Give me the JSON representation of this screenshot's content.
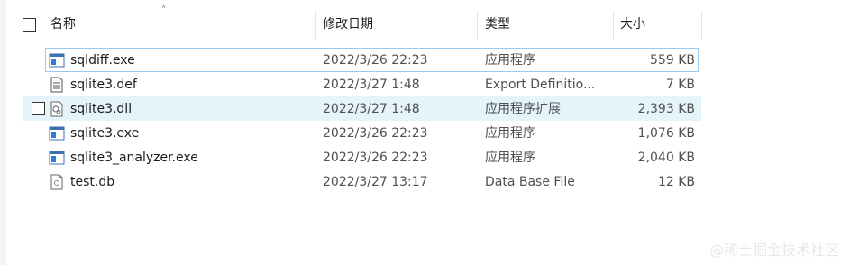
{
  "columns": {
    "name": "名称",
    "date": "修改日期",
    "type": "类型",
    "size": "大小"
  },
  "files": [
    {
      "name": "sqldiff.exe",
      "date": "2022/3/26 22:23",
      "type": "应用程序",
      "size": "559 KB",
      "icon": "exe-icon"
    },
    {
      "name": "sqlite3.def",
      "date": "2022/3/27 1:48",
      "type": "Export Definitio...",
      "size": "7 KB",
      "icon": "text-file-icon"
    },
    {
      "name": "sqlite3.dll",
      "date": "2022/3/27 1:48",
      "type": "应用程序扩展",
      "size": "2,393 KB",
      "icon": "dll-icon"
    },
    {
      "name": "sqlite3.exe",
      "date": "2022/3/26 22:23",
      "type": "应用程序",
      "size": "1,076 KB",
      "icon": "exe-icon"
    },
    {
      "name": "sqlite3_analyzer.exe",
      "date": "2022/3/26 22:23",
      "type": "应用程序",
      "size": "2,040 KB",
      "icon": "exe-icon"
    },
    {
      "name": "test.db",
      "date": "2022/3/27 13:17",
      "type": "Data Base File",
      "size": "12 KB",
      "icon": "generic-file-icon"
    }
  ],
  "watermark": "@稀土掘金技术社区",
  "colors": {
    "hover": "#e5f3fb",
    "focus_border": "#99c9ef"
  }
}
